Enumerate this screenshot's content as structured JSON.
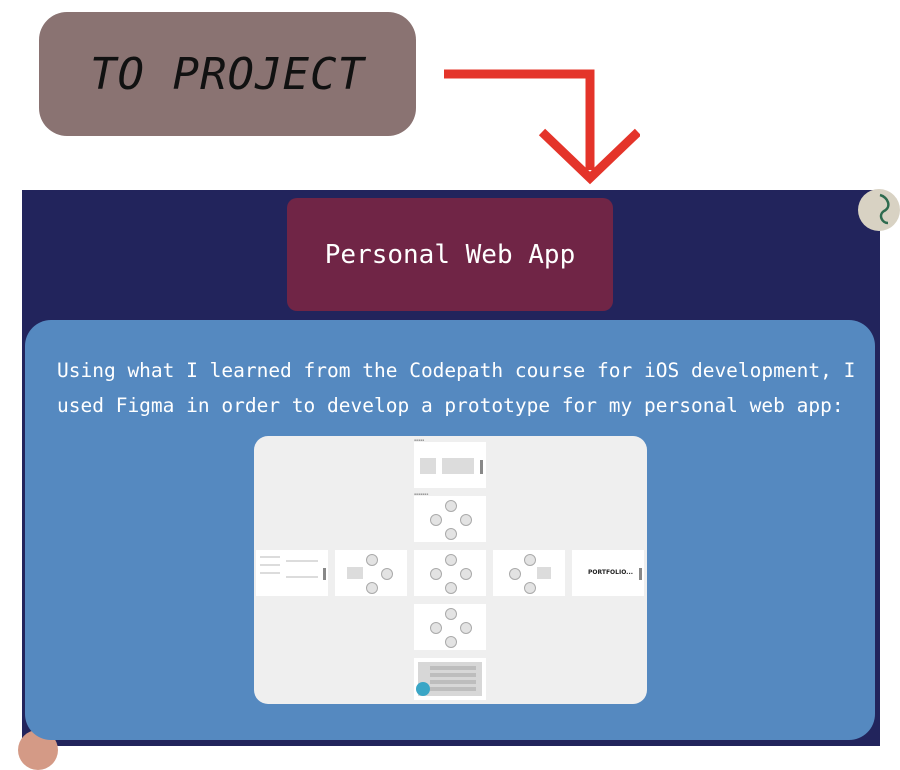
{
  "cta": {
    "label": "TO PROJECT"
  },
  "project": {
    "title": "Personal Web App",
    "description": "Using what I learned from the Codepath course for iOS development, I used Figma in order to develop a prototype for my personal web app:"
  },
  "prototype": {
    "portfolio_label": "PORTFOLIO..."
  },
  "colors": {
    "cta_bg": "#8a7372",
    "arrow": "#e4342a",
    "panel_bg": "#22245c",
    "title_bg": "#702546",
    "card_bg": "#5589c0",
    "proto_bg": "#efefef"
  }
}
